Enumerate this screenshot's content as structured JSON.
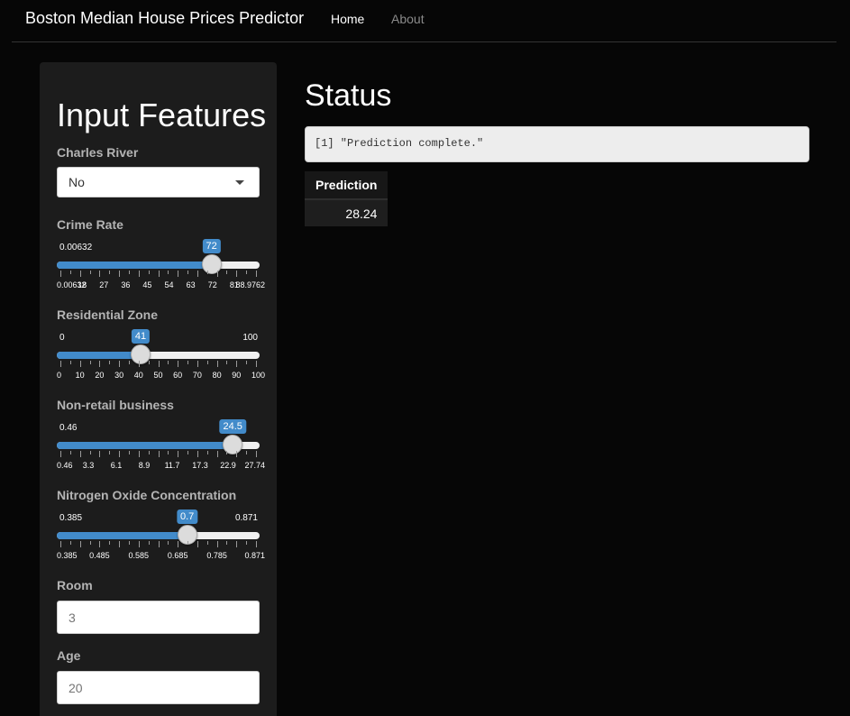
{
  "navbar": {
    "brand": "Boston Median House Prices Predictor",
    "home_label": "Home",
    "about_label": "About"
  },
  "sidebar": {
    "title": "Input Features",
    "charles_river": {
      "label": "Charles River",
      "value": "No"
    },
    "crime_rate": {
      "label": "Crime Rate",
      "min": "0.00632",
      "max": "",
      "value": "72",
      "fraction": 0.7727,
      "tick_labels": [
        "0.00632",
        "18",
        "27",
        "36",
        "45",
        "54",
        "63",
        "72",
        "81",
        "88.9762"
      ]
    },
    "residential_zone": {
      "label": "Residential Zone",
      "min": "0",
      "max": "100",
      "value": "41",
      "fraction": 0.41,
      "tick_labels": [
        "0",
        "10",
        "20",
        "30",
        "40",
        "50",
        "60",
        "70",
        "80",
        "90",
        "100"
      ]
    },
    "non_retail": {
      "label": "Non-retail business",
      "min": "0.46",
      "max": "",
      "value": "24.5",
      "fraction": 0.881,
      "tick_labels": [
        "0.46",
        "3.3",
        "6.1",
        "8.9",
        "11.7",
        "17.3",
        "22.9",
        "27.74"
      ]
    },
    "nox": {
      "label": "Nitrogen Oxide Concentration",
      "min": "0.385",
      "max": "0.871",
      "value": "0.7",
      "fraction": 0.648,
      "tick_labels": [
        "0.385",
        "0.485",
        "0.585",
        "0.685",
        "0.785",
        "0.871"
      ]
    },
    "room": {
      "label": "Room",
      "placeholder": "3"
    },
    "age": {
      "label": "Age",
      "placeholder": "20"
    }
  },
  "main": {
    "title": "Status",
    "status_output": "[1] \"Prediction complete.\"",
    "table": {
      "header": "Prediction",
      "value": "28.24"
    }
  }
}
